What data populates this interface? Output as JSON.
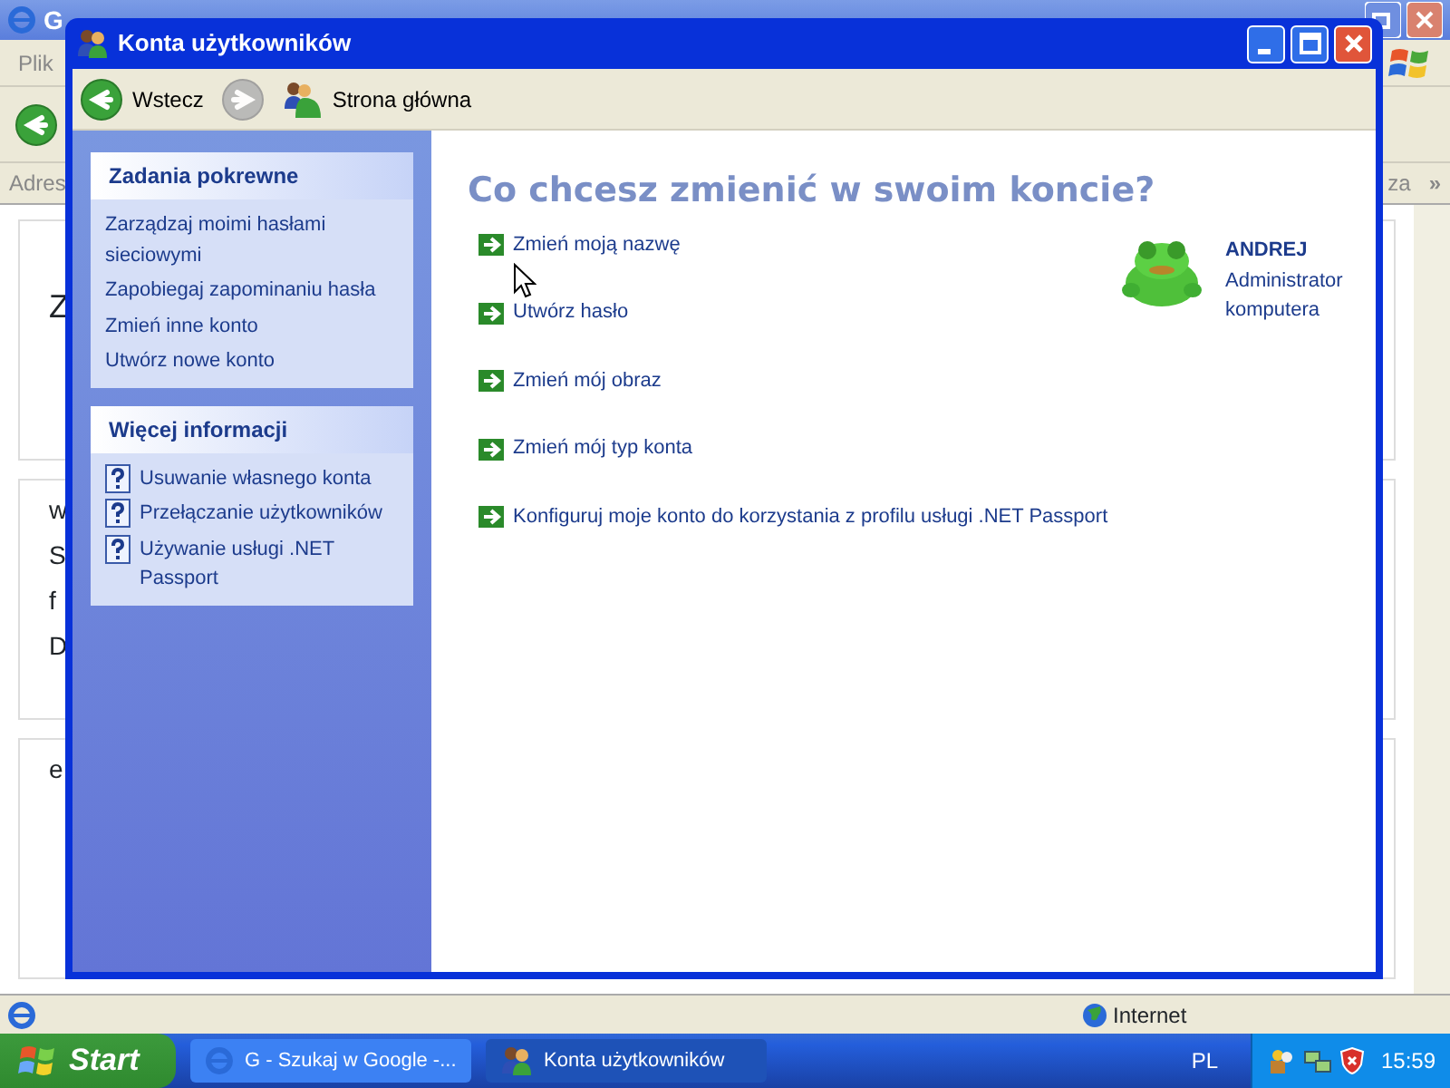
{
  "background_window": {
    "title_fragment": "G",
    "menu": [
      "Plik"
    ],
    "address_label": "Adres",
    "links_fragment": "za",
    "chevron": "»",
    "page_fragments": [
      "Z",
      "w",
      "S",
      "f",
      "D",
      "e"
    ],
    "status": "Internet"
  },
  "window": {
    "title": "Konta użytkowników",
    "toolbar": [
      {
        "kind": "back",
        "label": "Wstecz",
        "disabled": false
      },
      {
        "kind": "forward",
        "disabled": true
      },
      {
        "kind": "home",
        "label": "Strona główna",
        "disabled": false
      }
    ]
  },
  "sidebar": {
    "panels": [
      {
        "title": "Zadania pokrewne",
        "items": [
          {
            "kind": "task",
            "label": "Zarządzaj moimi hasłami sieciowymi"
          },
          {
            "kind": "task",
            "label": "Zapobiegaj zapominaniu hasła"
          },
          {
            "kind": "task",
            "label": "Zmień inne konto"
          },
          {
            "kind": "task",
            "label": "Utwórz nowe konto"
          }
        ]
      },
      {
        "title": "Więcej informacji",
        "items": [
          {
            "kind": "help",
            "label": "Usuwanie własnego konta"
          },
          {
            "kind": "help",
            "label": "Przełączanie użytkowników"
          },
          {
            "kind": "help",
            "label": "Używanie usługi .NET Passport"
          }
        ]
      }
    ]
  },
  "main": {
    "heading": "Co chcesz zmienić w swoim koncie?",
    "actions": [
      "Zmień moją nazwę",
      "Utwórz hasło",
      "Zmień mój obraz",
      "Zmień mój typ konta",
      "Konfiguruj moje konto do korzystania z profilu usługi .NET Passport"
    ],
    "account": {
      "name": "ANDREJ",
      "role": "Administrator komputera",
      "kind": "picture"
    }
  },
  "taskbar": {
    "start": "Start",
    "tasks": [
      {
        "label": "G - Szukaj w Google -...",
        "selected": false,
        "kind": "ie"
      },
      {
        "label": "Konta użytkowników",
        "selected": true,
        "kind": "users"
      }
    ],
    "language": "PL",
    "clock": "15:59"
  }
}
